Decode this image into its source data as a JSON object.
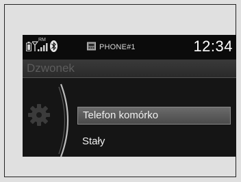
{
  "status": {
    "phone": "PHONE#1",
    "time": "12:34",
    "roaming": "RM"
  },
  "header": {
    "title": "Dzwonek"
  },
  "menu": {
    "items": [
      {
        "label": "Telefon komórko",
        "selected": true
      },
      {
        "label": "Stały",
        "selected": false
      }
    ]
  }
}
